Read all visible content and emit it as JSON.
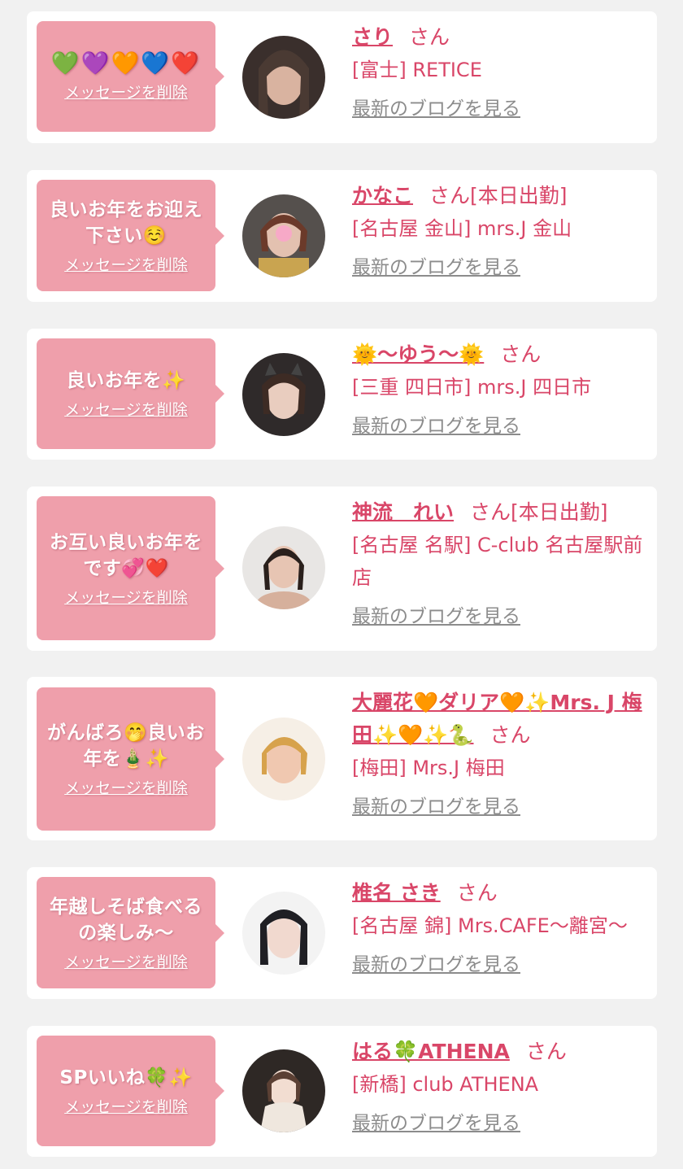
{
  "delete_label": "メッセージを削除",
  "blog_label": "最新のブログを見る",
  "san_label": "さん",
  "colors": {
    "page_bg": "#f1f1f1",
    "bubble": "#ef9fab",
    "accent_text": "#d94668",
    "link_gray": "#8c8c8c"
  },
  "messages": [
    {
      "message": "💚💜🧡💙❤️",
      "name": "さり",
      "status": "",
      "shop": "[富士] RETICE"
    },
    {
      "message": "良いお年をお迎え下さい☺️",
      "name": "かなこ",
      "status": "[本日出勤]",
      "shop": "[名古屋 金山] mrs.J 金山"
    },
    {
      "message": "良いお年を✨",
      "name": "🌞〜ゆう〜🌞",
      "status": "",
      "shop": "[三重 四日市] mrs.J 四日市"
    },
    {
      "message": "お互い良いお年をです💞❤️",
      "name": "神流　れい",
      "status": "[本日出勤]",
      "shop": "[名古屋 名駅] C-club 名古屋駅前店"
    },
    {
      "message": "がんばろ🤭良いお年を🎍✨",
      "name": "大麗花🧡ダリア🧡✨Mrs. J 梅田✨🧡✨🐍",
      "status": "",
      "shop": "[梅田] Mrs.J 梅田"
    },
    {
      "message": "年越しそば食べるの楽しみ〜",
      "name": "椎名 さき",
      "status": "",
      "shop": "[名古屋 錦] Mrs.CAFE〜離宮〜"
    },
    {
      "message": "SPいいね🍀✨",
      "name": "はる🍀ATHENA",
      "status": "",
      "shop": "[新橋] club ATHENA"
    }
  ]
}
